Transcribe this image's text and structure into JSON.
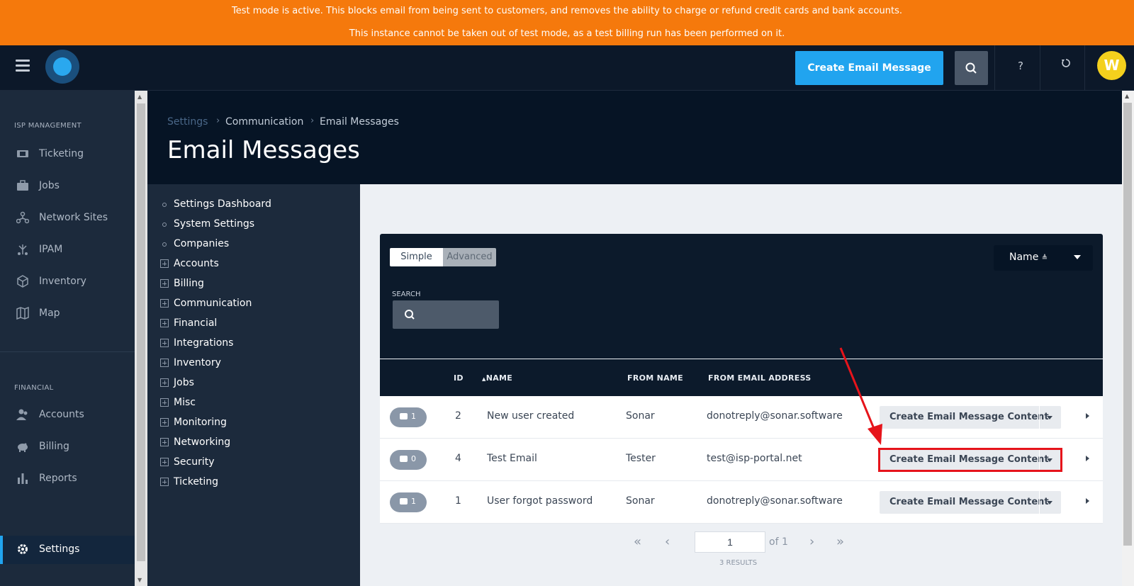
{
  "banner": {
    "line1": "Test mode is active. This blocks email from being sent to customers, and removes the ability to charge or refund credit cards and bank accounts.",
    "line2": "This instance cannot be taken out of test mode, as a test billing run has been performed on it."
  },
  "topbar": {
    "create_label": "Create Email Message",
    "help_label": "?",
    "avatar_letter": "W"
  },
  "leftnav": {
    "section1": "ISP MANAGEMENT",
    "items1": [
      {
        "label": "Ticketing",
        "icon": "ticket-icon"
      },
      {
        "label": "Jobs",
        "icon": "briefcase-icon"
      },
      {
        "label": "Network Sites",
        "icon": "network-icon"
      },
      {
        "label": "IPAM",
        "icon": "ipam-icon"
      },
      {
        "label": "Inventory",
        "icon": "box-icon"
      },
      {
        "label": "Map",
        "icon": "map-icon"
      }
    ],
    "section2": "FINANCIAL",
    "items2": [
      {
        "label": "Accounts",
        "icon": "users-icon"
      },
      {
        "label": "Billing",
        "icon": "piggy-bank-icon"
      },
      {
        "label": "Reports",
        "icon": "bar-chart-icon"
      }
    ],
    "settings_label": "Settings"
  },
  "breadcrumb": {
    "a": "Settings",
    "b": "Communication",
    "c": "Email Messages"
  },
  "page_title": "Email Messages",
  "settings_menu": {
    "simple": [
      "Settings Dashboard",
      "System Settings",
      "Companies"
    ],
    "expandable": [
      "Accounts",
      "Billing",
      "Communication",
      "Financial",
      "Integrations",
      "Inventory",
      "Jobs",
      "Misc",
      "Monitoring",
      "Networking",
      "Security",
      "Ticketing"
    ]
  },
  "filter": {
    "simple_label": "Simple",
    "advanced_label": "Advanced",
    "sort_label": "Name",
    "search_label": "SEARCH",
    "search_value": ""
  },
  "table": {
    "headers": {
      "id": "ID",
      "name": "NAME",
      "from_name": "FROM NAME",
      "from_email": "FROM EMAIL ADDRESS"
    },
    "rows": [
      {
        "count": "1",
        "id": "2",
        "name": "New user created",
        "from_name": "Sonar",
        "from_email": "donotreply@sonar.software",
        "action": "Create Email Message Content"
      },
      {
        "count": "0",
        "id": "4",
        "name": "Test Email",
        "from_name": "Tester",
        "from_email": "test@isp-portal.net",
        "action": "Create Email Message Content"
      },
      {
        "count": "1",
        "id": "1",
        "name": "User forgot password",
        "from_name": "Sonar",
        "from_email": "donotreply@sonar.software",
        "action": "Create Email Message Content"
      }
    ]
  },
  "pager": {
    "page": "1",
    "of": "of 1",
    "results": "3 RESULTS"
  },
  "colors": {
    "banner": "#f5790c",
    "accent": "#21a4ef",
    "highlight": "#e6141b"
  }
}
